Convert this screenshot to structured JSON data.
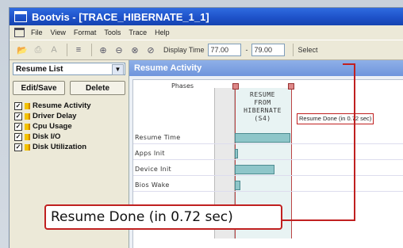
{
  "window": {
    "title": "Bootvis - [TRACE_HIBERNATE_1_1]"
  },
  "menu": [
    "File",
    "View",
    "Format",
    "Tools",
    "Trace",
    "Help"
  ],
  "toolbar": {
    "display_time_label": "Display Time",
    "display_time_value": "77.00",
    "separator": "-",
    "end_time_value": "79.00",
    "select_label": "Select"
  },
  "sidebar": {
    "dropdown_value": "Resume List",
    "edit_save_label": "Edit/Save",
    "delete_label": "Delete",
    "categories": [
      {
        "label": "Resume Activity",
        "checked": true
      },
      {
        "label": "Driver Delay",
        "checked": true
      },
      {
        "label": "Cpu Usage",
        "checked": true
      },
      {
        "label": "Disk I/O",
        "checked": true
      },
      {
        "label": "Disk Utilization",
        "checked": true
      }
    ]
  },
  "main": {
    "pane_title": "Resume Activity",
    "phases_label": "Phases",
    "phase_lines": [
      "RESUME",
      "FROM",
      "HIBERNATE",
      "(S4)"
    ],
    "rows": [
      {
        "label": "Resume Time",
        "bar_start_fraction": 0.0,
        "bar_width_fraction": 1.0
      },
      {
        "label": "Apps Init",
        "bar_start_fraction": 0.0,
        "bar_width_fraction": 0.05
      },
      {
        "label": "Device Init",
        "bar_start_fraction": 0.0,
        "bar_width_fraction": 0.72
      },
      {
        "label": "Bios Wake",
        "bar_start_fraction": 0.0,
        "bar_width_fraction": 0.1
      }
    ],
    "small_callout": "Resume Done (in 0.72 sec)"
  },
  "callout": {
    "text": "Resume Done (in 0.72 sec)"
  },
  "colors": {
    "accent": "#c02020",
    "title_bar": "#1e52c9",
    "bar_fill": "#8ec6c9"
  }
}
